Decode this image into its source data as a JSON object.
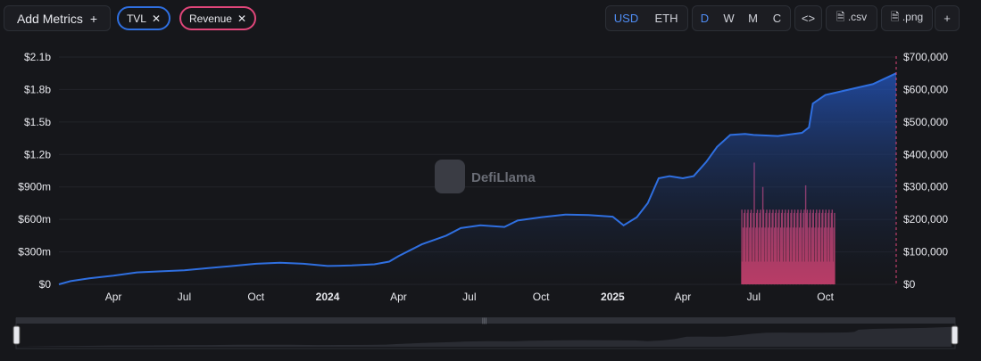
{
  "toolbar": {
    "add_metrics_label": "Add Metrics",
    "add_icon": "+",
    "metric_pills": [
      {
        "label": "TVL",
        "color": "#2f6fe0"
      },
      {
        "label": "Revenue",
        "color": "#e0467a"
      }
    ],
    "close_icon": "✕",
    "currency_options": [
      "USD",
      "ETH"
    ],
    "currency_selected": "USD",
    "period_options": [
      "D",
      "W",
      "M",
      "C"
    ],
    "period_selected": "D",
    "embed_icon": "<>",
    "csv_label": ".csv",
    "png_label": ".png",
    "plus_label": "+"
  },
  "watermark": "DefiLlama",
  "colors": {
    "tvl": "#2f6fe0",
    "revenue": "#e0467a",
    "background": "#16171b",
    "accent": "#4f8df5"
  },
  "chart_data": {
    "type": "area",
    "x_tick_labels": [
      "Apr",
      "Jul",
      "Oct",
      "2024",
      "Apr",
      "Jul",
      "Oct",
      "2025",
      "Apr",
      "Jul",
      "Oct"
    ],
    "y_left_ticks": [
      "$0",
      "$300m",
      "$600m",
      "$900m",
      "$1.2b",
      "$1.5b",
      "$1.8b",
      "$2.1b"
    ],
    "y_right_ticks": [
      "$0",
      "$100,000",
      "$200,000",
      "$300,000",
      "$400,000",
      "$500,000",
      "$600,000",
      "$700,000"
    ],
    "y_left_range": [
      0,
      2100000000
    ],
    "y_right_range": [
      0,
      700000
    ],
    "x_range": [
      "2023-01-21",
      "2025-12-31"
    ],
    "grid": true,
    "series": [
      {
        "name": "TVL",
        "axis": "left",
        "points": [
          [
            "2023-01-21",
            0
          ],
          [
            "2023-02-05",
            30000000
          ],
          [
            "2023-03-01",
            55000000
          ],
          [
            "2023-04-01",
            80000000
          ],
          [
            "2023-05-01",
            110000000
          ],
          [
            "2023-06-01",
            120000000
          ],
          [
            "2023-07-01",
            130000000
          ],
          [
            "2023-08-01",
            150000000
          ],
          [
            "2023-09-01",
            170000000
          ],
          [
            "2023-10-01",
            190000000
          ],
          [
            "2023-11-01",
            200000000
          ],
          [
            "2023-12-01",
            190000000
          ],
          [
            "2024-01-01",
            170000000
          ],
          [
            "2024-02-01",
            175000000
          ],
          [
            "2024-03-01",
            185000000
          ],
          [
            "2024-03-20",
            210000000
          ],
          [
            "2024-04-01",
            260000000
          ],
          [
            "2024-05-01",
            370000000
          ],
          [
            "2024-06-01",
            450000000
          ],
          [
            "2024-06-20",
            520000000
          ],
          [
            "2024-07-15",
            545000000
          ],
          [
            "2024-08-15",
            530000000
          ],
          [
            "2024-09-01",
            590000000
          ],
          [
            "2024-10-01",
            620000000
          ],
          [
            "2024-11-01",
            645000000
          ],
          [
            "2024-12-01",
            640000000
          ],
          [
            "2025-01-01",
            625000000
          ],
          [
            "2025-01-15",
            545000000
          ],
          [
            "2025-02-01",
            620000000
          ],
          [
            "2025-02-15",
            750000000
          ],
          [
            "2025-03-01",
            980000000
          ],
          [
            "2025-03-15",
            1000000000
          ],
          [
            "2025-04-01",
            980000000
          ],
          [
            "2025-04-15",
            1000000000
          ],
          [
            "2025-05-01",
            1130000000
          ],
          [
            "2025-05-15",
            1270000000
          ],
          [
            "2025-06-01",
            1380000000
          ],
          [
            "2025-06-20",
            1390000000
          ],
          [
            "2025-07-01",
            1380000000
          ],
          [
            "2025-08-01",
            1370000000
          ],
          [
            "2025-09-01",
            1400000000
          ],
          [
            "2025-09-10",
            1450000000
          ],
          [
            "2025-09-15",
            1670000000
          ],
          [
            "2025-10-01",
            1750000000
          ],
          [
            "2025-11-01",
            1800000000
          ],
          [
            "2025-12-01",
            1850000000
          ],
          [
            "2025-12-31",
            1950000000
          ]
        ]
      },
      {
        "name": "Revenue",
        "axis": "right",
        "type": "bar",
        "start": "2025-06-15",
        "end": "2025-10-12",
        "typical_range": [
          70000,
          230000
        ],
        "peaks": [
          [
            "2025-07-01",
            375000
          ],
          [
            "2025-07-12",
            300000
          ],
          [
            "2025-09-05",
            305000
          ]
        ]
      }
    ]
  }
}
